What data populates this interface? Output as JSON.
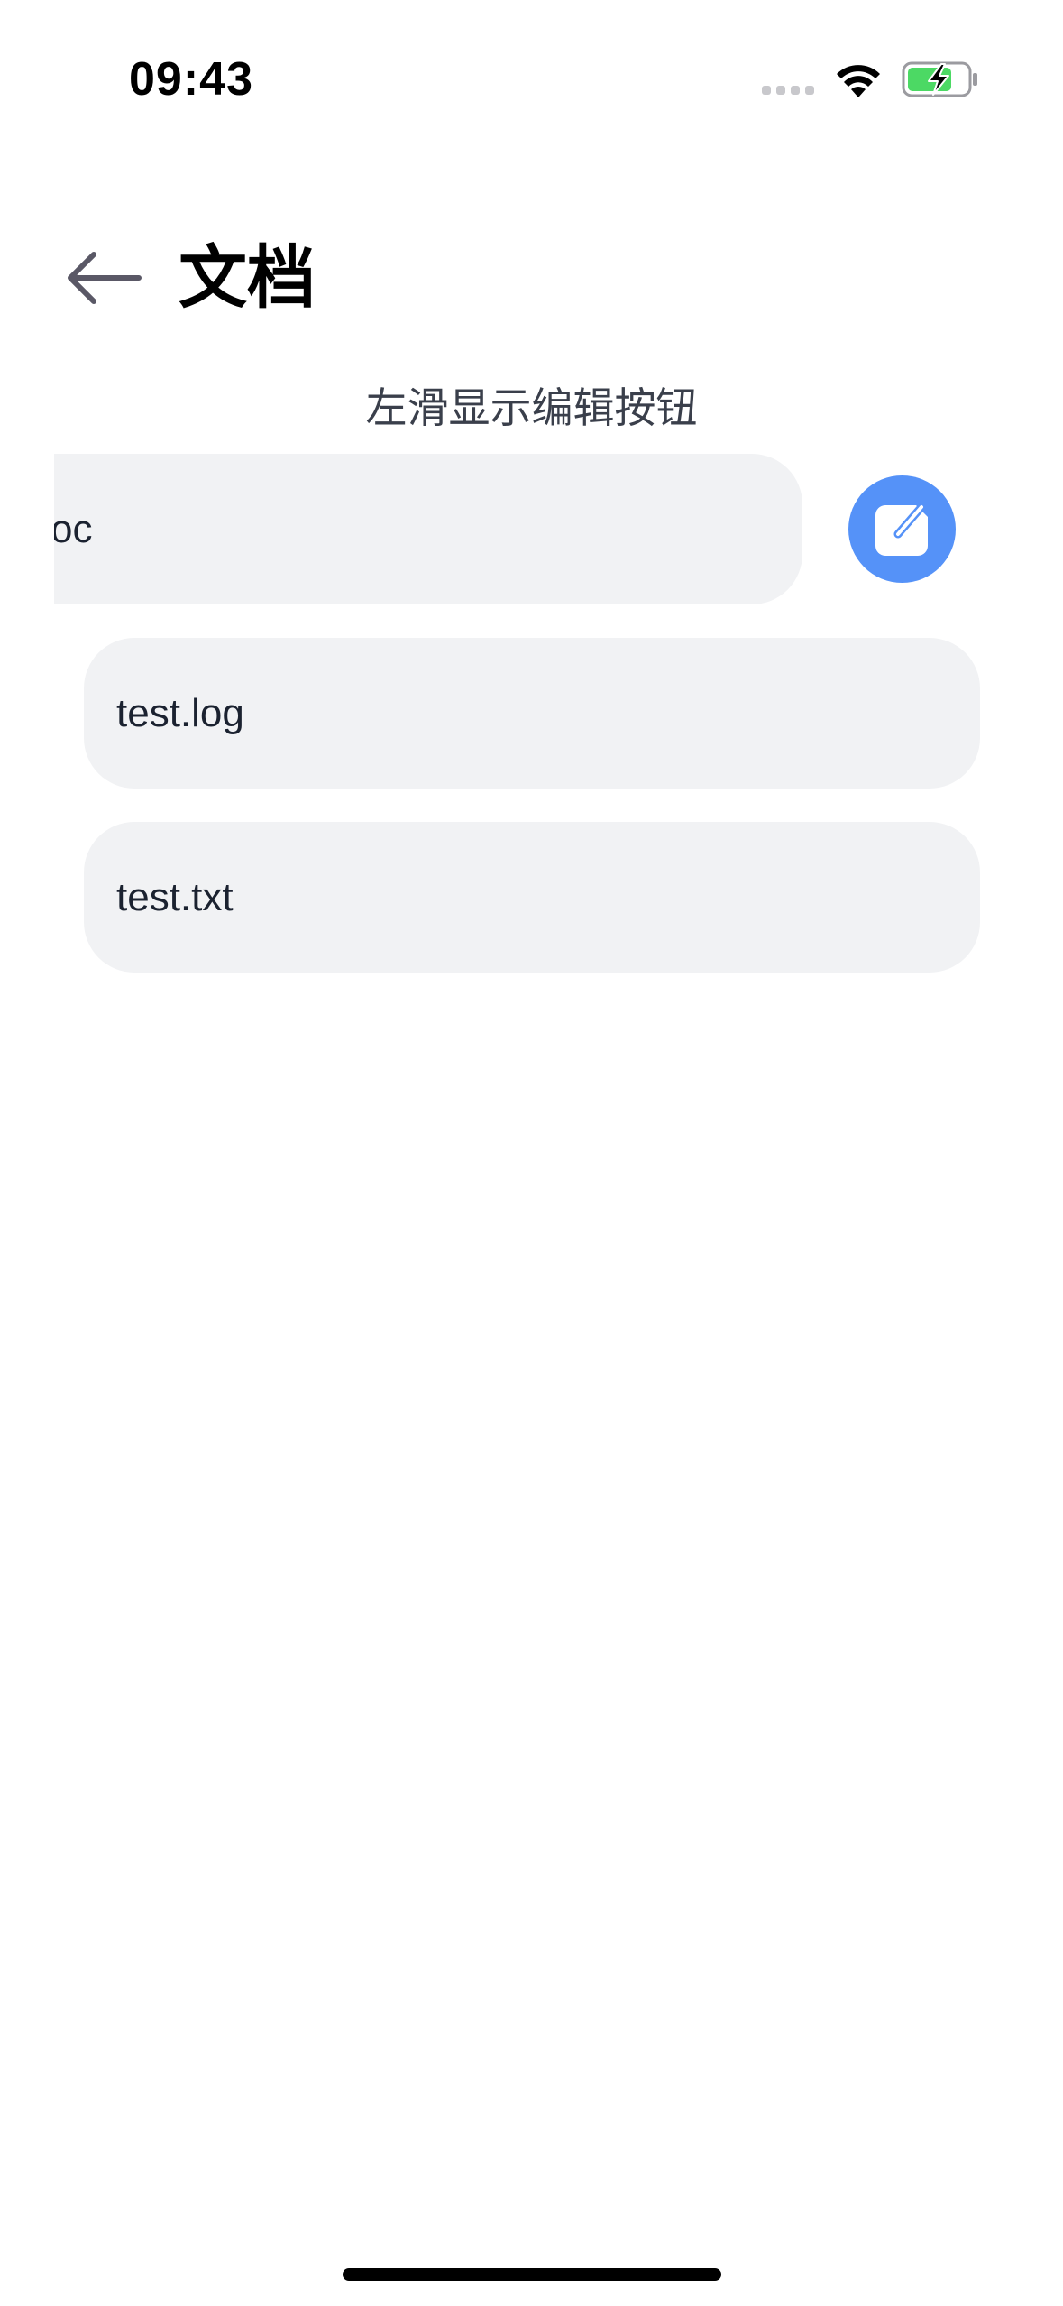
{
  "status_bar": {
    "time": "09:43"
  },
  "header": {
    "back_icon": "arrow-left-icon",
    "title": "文档"
  },
  "hint": "左滑显示编辑按钮",
  "list": {
    "items": [
      {
        "label": "test.doc",
        "visible_label": "oc",
        "swiped": true
      },
      {
        "label": "test.log"
      },
      {
        "label": "test.txt"
      }
    ],
    "edit_icon": "edit-icon"
  },
  "colors": {
    "accent": "#5592f8",
    "item_background": "#f1f2f4",
    "text": "#1b2230",
    "hint_text": "#3a3f4b",
    "back_icon": "#5a5866"
  }
}
